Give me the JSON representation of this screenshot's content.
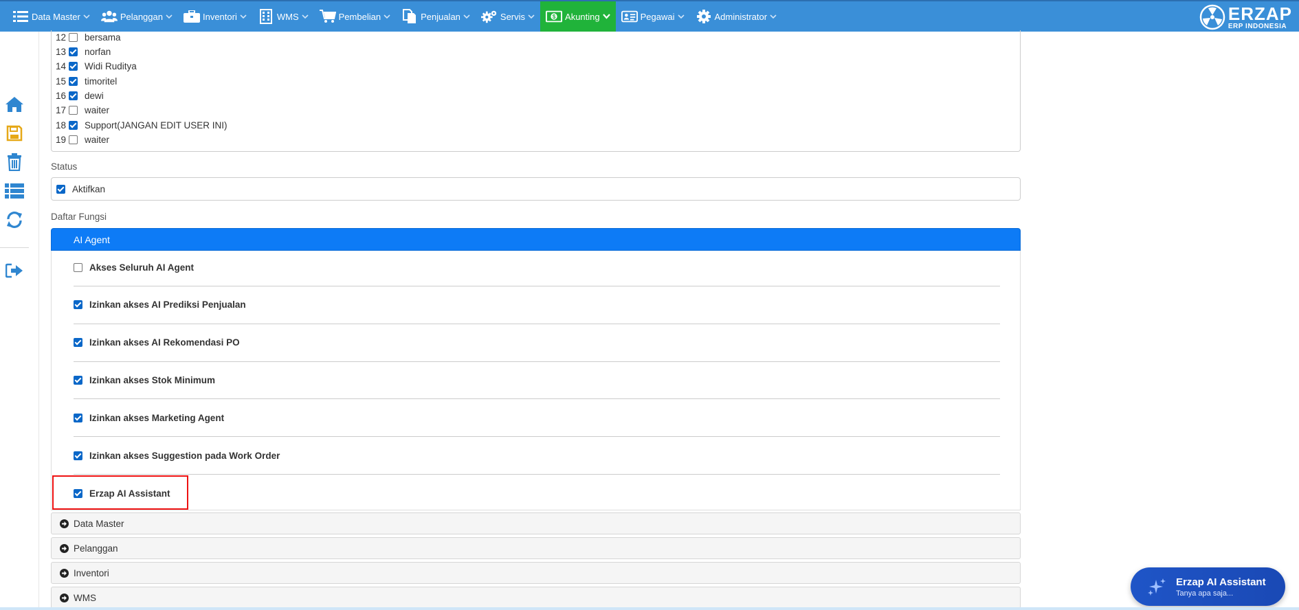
{
  "nav": {
    "items": [
      {
        "label": "Data Master",
        "icon": "list-icon"
      },
      {
        "label": "Pelanggan",
        "icon": "users-icon"
      },
      {
        "label": "Inventori",
        "icon": "briefcase-icon"
      },
      {
        "label": "WMS",
        "icon": "building-icon"
      },
      {
        "label": "Pembelian",
        "icon": "cart-icon"
      },
      {
        "label": "Penjualan",
        "icon": "documents-icon"
      },
      {
        "label": "Servis",
        "icon": "gears-icon"
      },
      {
        "label": "Akunting",
        "icon": "money-icon",
        "active": true
      },
      {
        "label": "Pegawai",
        "icon": "id-card-icon"
      },
      {
        "label": "Administrator",
        "icon": "gear-icon"
      }
    ],
    "logo_name": "ERZAP",
    "logo_sub": "ERP INDONESIA"
  },
  "sidebar": [
    "home-icon",
    "save-icon",
    "trash-icon",
    "list-icon",
    "refresh-icon",
    "sign-out-icon"
  ],
  "users": [
    {
      "no": "12",
      "name": "bersama",
      "checked": false
    },
    {
      "no": "13",
      "name": "norfan",
      "checked": true
    },
    {
      "no": "14",
      "name": "Widi Ruditya",
      "checked": true
    },
    {
      "no": "15",
      "name": "timoritel",
      "checked": true
    },
    {
      "no": "16",
      "name": "dewi",
      "checked": true
    },
    {
      "no": "17",
      "name": "waiter",
      "checked": false
    },
    {
      "no": "18",
      "name": "Support(JANGAN EDIT USER INI)",
      "checked": true
    },
    {
      "no": "19",
      "name": "waiter",
      "checked": false
    }
  ],
  "status": {
    "label": "Status",
    "option": "Aktifkan",
    "checked": true
  },
  "functions": {
    "label": "Daftar Fungsi",
    "open_panel": {
      "title": "AI Agent",
      "items": [
        {
          "label": "Akses Seluruh AI Agent",
          "checked": false
        },
        {
          "label": "Izinkan akses AI Prediksi Penjualan",
          "checked": true
        },
        {
          "label": "Izinkan akses AI Rekomendasi PO",
          "checked": true
        },
        {
          "label": "Izinkan akses Stok Minimum",
          "checked": true
        },
        {
          "label": "Izinkan akses Marketing Agent",
          "checked": true
        },
        {
          "label": "Izinkan akses Suggestion pada Work Order",
          "checked": true
        },
        {
          "label": "Erzap AI Assistant",
          "checked": true
        }
      ]
    },
    "collapsed_panels": [
      "Data Master",
      "Pelanggan",
      "Inventori",
      "WMS"
    ]
  },
  "ai_assistant": {
    "title": "Erzap AI Assistant",
    "subtitle": "Tanya apa saja..."
  }
}
